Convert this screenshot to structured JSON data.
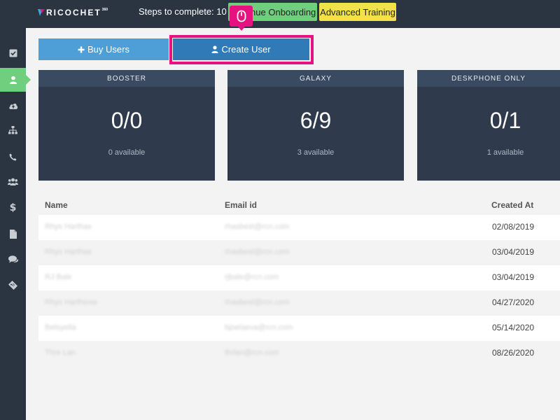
{
  "topbar": {
    "brand": "RICOCHET",
    "brand_sup": "360",
    "steps_label": "Steps to complete: 10",
    "continue_onboarding": "Continue Onboarding",
    "advanced_training": "Advanced Training"
  },
  "colors": {
    "nav_bg": "#2b3542",
    "accent_green": "#6fcf7e",
    "accent_yellow": "#f1e24a",
    "highlight": "#e5127f",
    "button_blue": "#4e9ed8",
    "button_blue_dark": "#2f7ab7"
  },
  "sidebar": {
    "items": [
      {
        "icon": "checkbox-icon",
        "active": false
      },
      {
        "icon": "user-icon",
        "active": true
      },
      {
        "icon": "cloud-upload-icon",
        "active": false
      },
      {
        "icon": "sitemap-icon",
        "active": false
      },
      {
        "icon": "phone-icon",
        "active": false
      },
      {
        "icon": "users-icon",
        "active": false
      },
      {
        "icon": "dollar-icon",
        "active": false
      },
      {
        "icon": "file-icon",
        "active": false
      },
      {
        "icon": "comments-icon",
        "active": false
      },
      {
        "icon": "ticket-icon",
        "active": false
      }
    ]
  },
  "actions": {
    "buy_users": "Buy Users",
    "create_user": "Create User"
  },
  "cards": [
    {
      "title": "BOOSTER",
      "count": "0/0",
      "available": "0 available"
    },
    {
      "title": "GALAXY",
      "count": "6/9",
      "available": "3 available"
    },
    {
      "title": "DESKPHONE ONLY",
      "count": "0/1",
      "available": "1 available"
    }
  ],
  "table": {
    "headers": {
      "name": "Name",
      "email": "Email id",
      "created": "Created At"
    },
    "rows": [
      {
        "name": "Rhys Harthas",
        "email": "rhasbest@rcn.com",
        "created": "02/08/2019"
      },
      {
        "name": "Rhys Harthas",
        "email": "rhasbest@rcn.com",
        "created": "03/04/2019"
      },
      {
        "name": "RJ Bale",
        "email": "rjbale@rcn.com",
        "created": "03/04/2019"
      },
      {
        "name": "Rhys Harthiose",
        "email": "rhasbest@rcn.com",
        "created": "04/27/2020"
      },
      {
        "name": "Betsyella",
        "email": "bjoelaeva@rcn.com",
        "created": "05/14/2020"
      },
      {
        "name": "Thre Lan",
        "email": "thrlan@rcn.com",
        "created": "08/26/2020"
      }
    ]
  }
}
